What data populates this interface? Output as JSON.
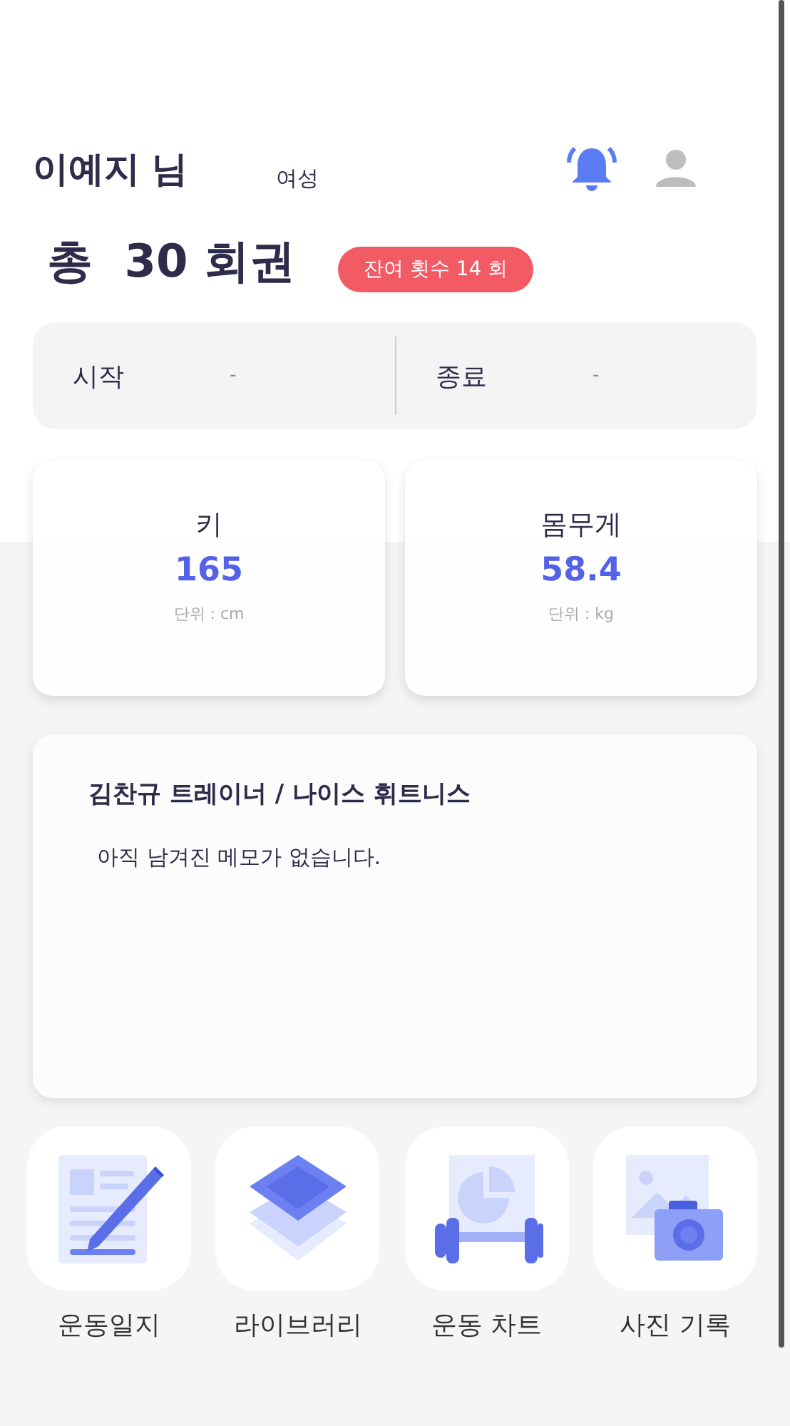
{
  "header": {
    "name": "이예지 님",
    "gender": "여성"
  },
  "summary": {
    "total": "총  30 회권",
    "remaining_badge": "잔여 횟수 14 회"
  },
  "period": [
    {
      "label": "시작",
      "value": "-"
    },
    {
      "label": "종료",
      "value": "-"
    }
  ],
  "measurements": [
    {
      "label": "키",
      "value": "165",
      "unit": "단위 : cm"
    },
    {
      "label": "몸무게",
      "value": "58.4",
      "unit": "단위 : kg"
    }
  ],
  "memo": {
    "title": "김찬규 트레이너 / 나이스 휘트니스",
    "text": "아직 남겨진 메모가 없습니다."
  },
  "menu": [
    {
      "kind": "log",
      "label": "운동일지"
    },
    {
      "kind": "library",
      "label": "라이브러리"
    },
    {
      "kind": "chart",
      "label": "운동 차트"
    },
    {
      "kind": "photo",
      "label": "사진 기록"
    }
  ]
}
